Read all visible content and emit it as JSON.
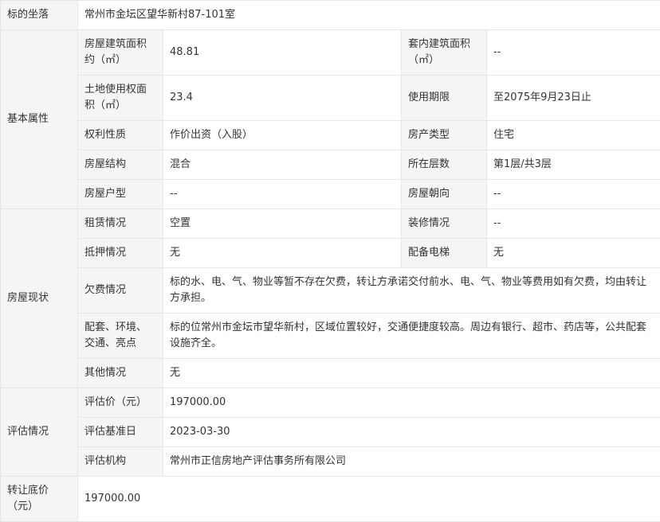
{
  "location": {
    "label": "标的坐落",
    "value": "常州市金坛区望华新村87-101室"
  },
  "basic": {
    "group_label": "基本属性",
    "building_area_label": "房屋建筑面积约（㎡）",
    "building_area_value": "48.81",
    "inner_area_label": "套内建筑面积（㎡）",
    "inner_area_value": "--",
    "land_area_label": "土地使用权面积（㎡）",
    "land_area_value": "23.4",
    "term_label": "使用期限",
    "term_value": "至2075年9月23日止",
    "right_nature_label": "权利性质",
    "right_nature_value": "作价出资（入股）",
    "property_type_label": "房产类型",
    "property_type_value": "住宅",
    "structure_label": "房屋结构",
    "structure_value": "混合",
    "floor_label": "所在层数",
    "floor_value": "第1层/共3层",
    "layout_label": "房屋户型",
    "layout_value": "--",
    "orientation_label": "房屋朝向",
    "orientation_value": "--"
  },
  "status": {
    "group_label": "房屋现状",
    "lease_label": "租赁情况",
    "lease_value": "空置",
    "decoration_label": "装修情况",
    "decoration_value": "--",
    "mortgage_label": "抵押情况",
    "mortgage_value": "无",
    "elevator_label": "配备电梯",
    "elevator_value": "无",
    "arrears_label": "欠费情况",
    "arrears_value": "标的水、电、气、物业等暂不存在欠费，转让方承诺交付前水、电、气、物业等费用如有欠费，均由转让方承担。",
    "facilities_label": "配套、环境、交通、亮点",
    "facilities_value": "标的位常州市金坛市望华新村，区域位置较好，交通便捷度较高。周边有银行、超市、药店等，公共配套设施齐全。",
    "other_label": "其他情况",
    "other_value": "无"
  },
  "appraisal": {
    "group_label": "评估情况",
    "price_label": "评估价（元）",
    "price_value": "197000.00",
    "date_label": "评估基准日",
    "date_value": "2023-03-30",
    "agency_label": "评估机构",
    "agency_value": "常州市正信房地产评估事务所有限公司"
  },
  "reserve": {
    "label": "转让底价（元）",
    "value": "197000.00"
  }
}
